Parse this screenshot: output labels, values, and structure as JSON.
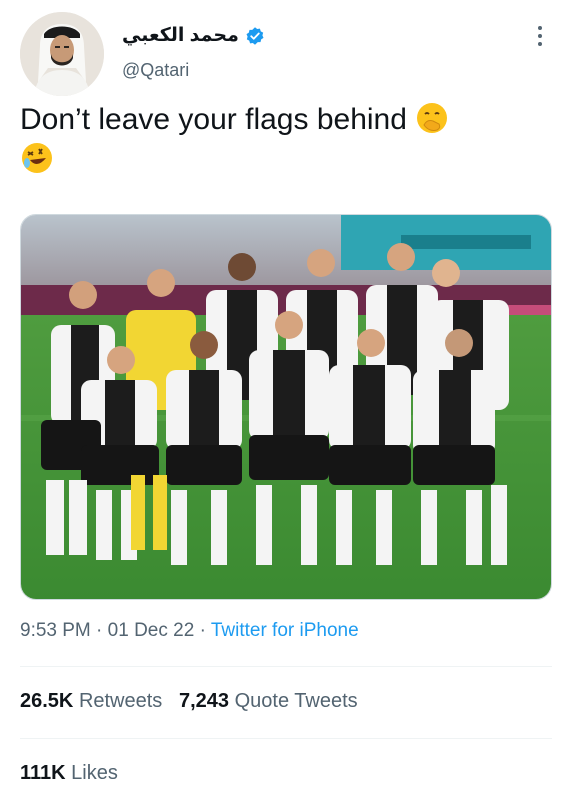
{
  "tweet": {
    "display_name": "محمد الكعبي",
    "handle": "@Qatari",
    "text": "Don’t leave your flags behind",
    "emojis": [
      "face-with-hand-over-mouth-emoji",
      "rolling-on-floor-laughing-emoji"
    ],
    "time": "9:53 PM",
    "separator": "·",
    "date": "01 Dec 22",
    "source": "Twitter for iPhone",
    "retweets_count": "26.5K",
    "retweets_label": "Retweets",
    "quotes_count": "7,243",
    "quotes_label": "Quote Tweets",
    "likes_count": "111K",
    "likes_label": "Likes"
  },
  "colors": {
    "text": "#0f1419",
    "secondary": "#536471",
    "accent": "#1d9bf0",
    "divider": "#eff3f4"
  },
  "icons": [
    "verified-badge-icon",
    "more-options-icon"
  ]
}
